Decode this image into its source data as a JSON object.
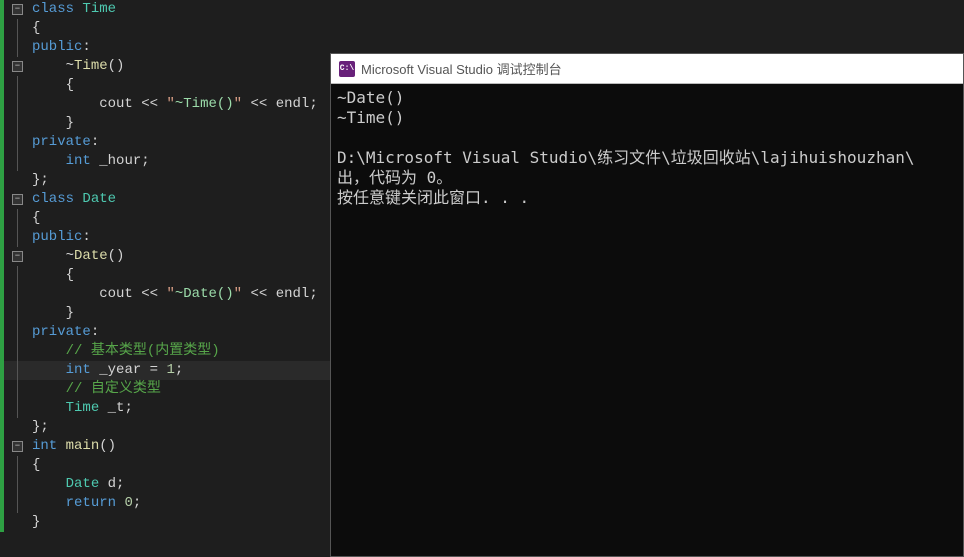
{
  "code": {
    "time_class": {
      "class_kw": "class",
      "name": "Time",
      "brace_open": "{",
      "public_kw": "public",
      "colon": ":",
      "dtor_tilde": "~",
      "dtor_name": "Time",
      "dtor_parens": "()",
      "dtor_brace_open": "{",
      "cout": "cout",
      "shl": "<<",
      "str_quote_open": "\"",
      "str_content": "~Time()",
      "str_quote_close": "\"",
      "endl": "endl",
      "semi": ";",
      "dtor_brace_close": "}",
      "private_kw": "private",
      "hour_type": "int",
      "hour_name": "_hour",
      "brace_close_semi": "};"
    },
    "date_class": {
      "class_kw": "class",
      "name": "Date",
      "brace_open": "{",
      "public_kw": "public",
      "colon": ":",
      "dtor_tilde": "~",
      "dtor_name": "Date",
      "dtor_parens": "()",
      "dtor_brace_open": "{",
      "cout": "cout",
      "shl": "<<",
      "str_quote_open": "\"",
      "str_content": "~Date()",
      "str_quote_close": "\"",
      "endl": "endl",
      "semi": ";",
      "dtor_brace_close": "}",
      "private_kw": "private",
      "comment1": "// 基本类型(内置类型)",
      "year_type": "int",
      "year_name": "_year",
      "year_eq": "=",
      "year_val": "1",
      "comment2": "// 自定义类型",
      "t_type": "Time",
      "t_name": "_t",
      "brace_close_semi": "};"
    },
    "main_fn": {
      "ret_type": "int",
      "name": "main",
      "parens": "()",
      "brace_open": "{",
      "d_type": "Date",
      "d_name": "d",
      "semi": ";",
      "return_kw": "return",
      "ret_val": "0",
      "brace_close": "}"
    }
  },
  "console": {
    "title": "Microsoft Visual Studio 调试控制台",
    "icon_text": "C:\\",
    "lines": {
      "l1": "~Date()",
      "l2": "~Time()",
      "l3": "",
      "l4": "D:\\Microsoft Visual Studio\\练习文件\\垃圾回收站\\lajihuishouzhan\\",
      "l5": "出，代码为 0。",
      "l6": "按任意键关闭此窗口. . ."
    }
  }
}
